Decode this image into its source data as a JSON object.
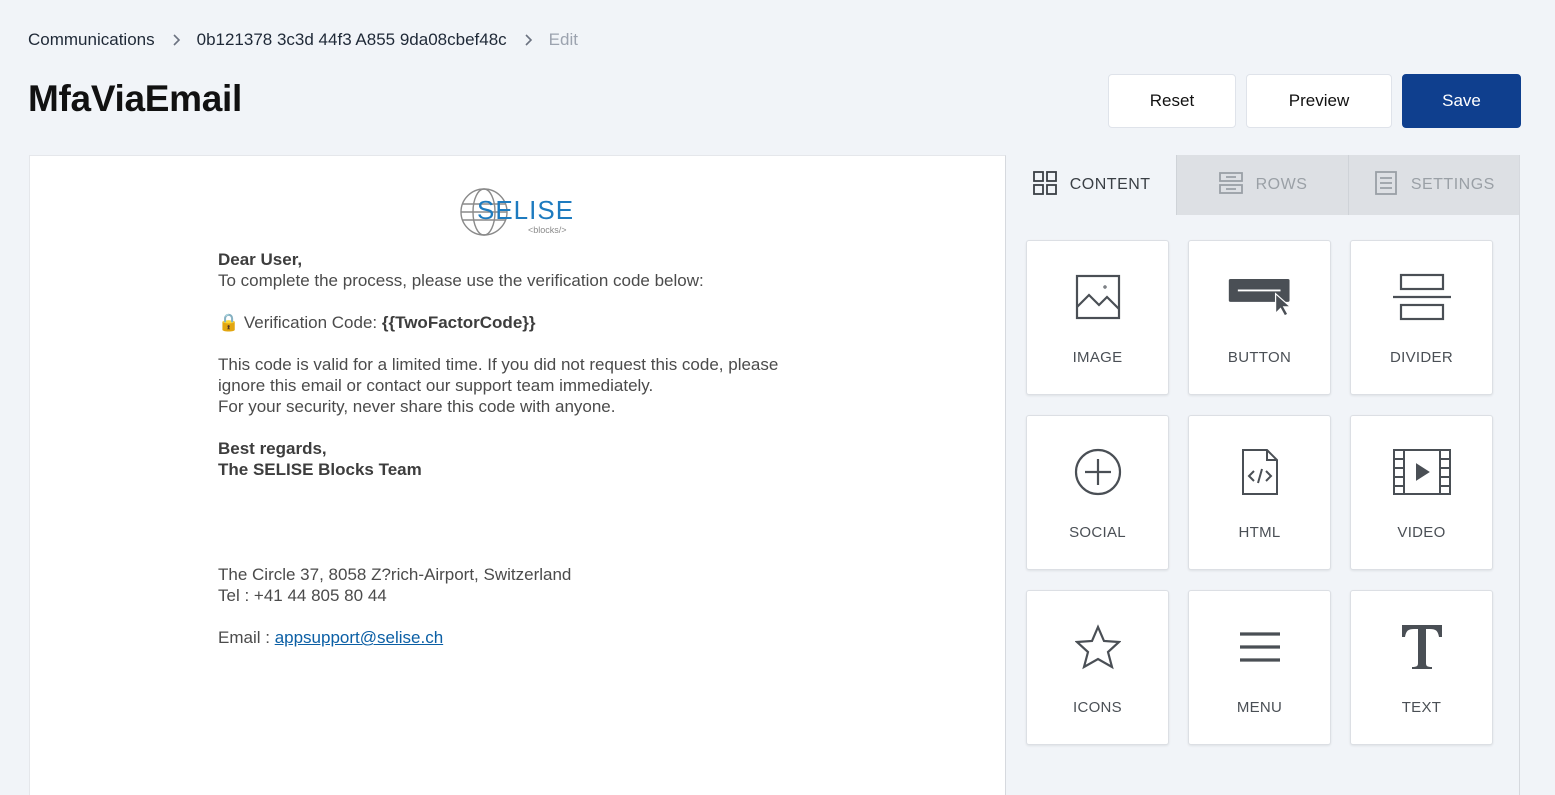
{
  "breadcrumb": {
    "items": [
      "Communications",
      "0b121378 3c3d 44f3 A855 9da08cbef48c",
      "Edit"
    ]
  },
  "page_title": "MfaViaEmail",
  "actions": {
    "reset_label": "Reset",
    "preview_label": "Preview",
    "save_label": "Save"
  },
  "email": {
    "logo_text": "SELISE",
    "logo_subtext": "<blocks/>",
    "greeting": "Dear User,",
    "intro": "To complete the process, please use the verification code below:",
    "code_prefix": "🔒 Verification Code: ",
    "code_value": "{{TwoFactorCode}}",
    "validity_line1": "This code is valid for a limited time. If you did not request this code, please",
    "validity_line2": "ignore this email or contact our support team immediately.",
    "security_line": "For your security, never share this code with anyone.",
    "signoff": "Best regards,",
    "team": "The SELISE Blocks Team",
    "address": "The Circle 37, 8058 Z?rich-Airport, Switzerland",
    "tel": "Tel :  +41 44 805 80 44",
    "email_label": "Email : ",
    "email_link": "appsupport@selise.ch"
  },
  "panel": {
    "tabs": [
      {
        "label": "CONTENT",
        "icon": "grid-icon",
        "active": true
      },
      {
        "label": "ROWS",
        "icon": "rows-icon",
        "active": false
      },
      {
        "label": "SETTINGS",
        "icon": "settings-doc-icon",
        "active": false
      }
    ],
    "tiles": [
      {
        "label": "IMAGE",
        "icon": "image-icon"
      },
      {
        "label": "BUTTON",
        "icon": "button-icon"
      },
      {
        "label": "DIVIDER",
        "icon": "divider-icon"
      },
      {
        "label": "SOCIAL",
        "icon": "plus-circle-icon"
      },
      {
        "label": "HTML",
        "icon": "code-file-icon"
      },
      {
        "label": "VIDEO",
        "icon": "video-icon"
      },
      {
        "label": "ICONS",
        "icon": "star-icon"
      },
      {
        "label": "MENU",
        "icon": "menu-icon"
      },
      {
        "label": "TEXT",
        "icon": "text-icon"
      }
    ]
  },
  "colors": {
    "primary": "#0f3f8e",
    "background": "#f1f4f8",
    "link": "#0b5fa5"
  }
}
